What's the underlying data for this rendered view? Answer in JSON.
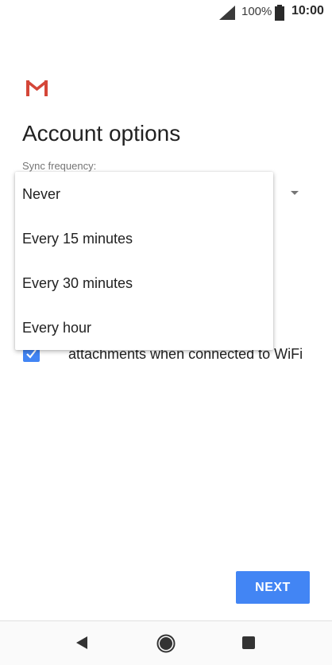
{
  "status_bar": {
    "battery_percent": "100%",
    "time": "10:00",
    "signal_icon": "signal-icon",
    "battery_icon": "battery-icon"
  },
  "header": {
    "logo_icon": "gmail-logo-icon",
    "title": "Account options"
  },
  "sync_frequency": {
    "label": "Sync frequency:",
    "dropdown_icon": "dropdown-arrow-icon",
    "options": [
      "Never",
      "Every 15 minutes",
      "Every 30 minutes",
      "Every hour"
    ]
  },
  "download_attachments": {
    "checked": true,
    "label_visible": "attachments when connected to WiFi"
  },
  "actions": {
    "next_label": "NEXT"
  },
  "colors": {
    "accent": "#4285f4",
    "gmail_red": "#d44638"
  },
  "nav_bar": {
    "back_icon": "back-icon",
    "home_icon": "home-icon",
    "recent_icon": "recent-apps-icon"
  }
}
